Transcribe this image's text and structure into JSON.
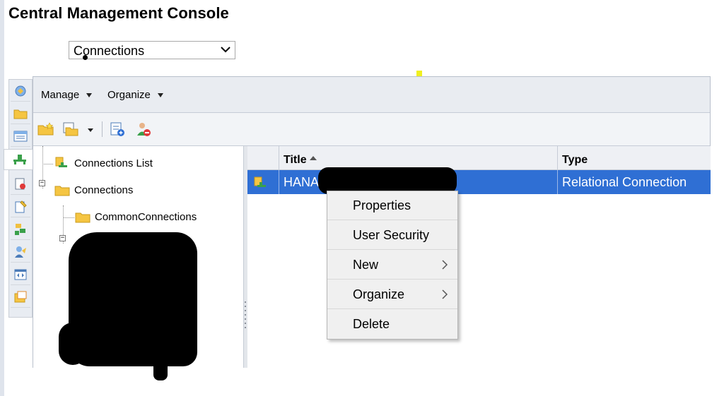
{
  "app": {
    "title": "Central Management Console",
    "section_select": {
      "value": "Connections"
    }
  },
  "menubar": {
    "items": [
      {
        "label": "Manage"
      },
      {
        "label": "Organize"
      }
    ]
  },
  "toolbar": {
    "buttons": [
      "new-folder-icon",
      "copy-to-folder-icon",
      "details-icon",
      "remove-user-icon"
    ]
  },
  "icon_rail": {
    "items": [
      "cms-icon",
      "folders-icon",
      "list-icon",
      "connections-icon",
      "documents-icon",
      "settings-icon",
      "servers-icon",
      "users-icon",
      "applications-icon",
      "categories-icon"
    ]
  },
  "tree": {
    "items": [
      {
        "label": "Connections List"
      },
      {
        "label": "Connections"
      },
      {
        "label": "CommonConnections"
      }
    ]
  },
  "grid": {
    "columns": [
      {
        "label": ""
      },
      {
        "label": "Title"
      },
      {
        "label": "Type"
      }
    ],
    "rows": [
      {
        "title": "HANA",
        "type": "Relational Connection"
      }
    ]
  },
  "context_menu": {
    "items": [
      {
        "label": "Properties",
        "submenu": false
      },
      {
        "label": "User Security",
        "submenu": false
      },
      {
        "label": "New",
        "submenu": true
      },
      {
        "label": "Organize",
        "submenu": true
      },
      {
        "label": "Delete",
        "submenu": false
      }
    ]
  },
  "colors": {
    "selection": "#2f6fd4",
    "menubar": "#e9ecf1",
    "folder": "#f5c542"
  }
}
